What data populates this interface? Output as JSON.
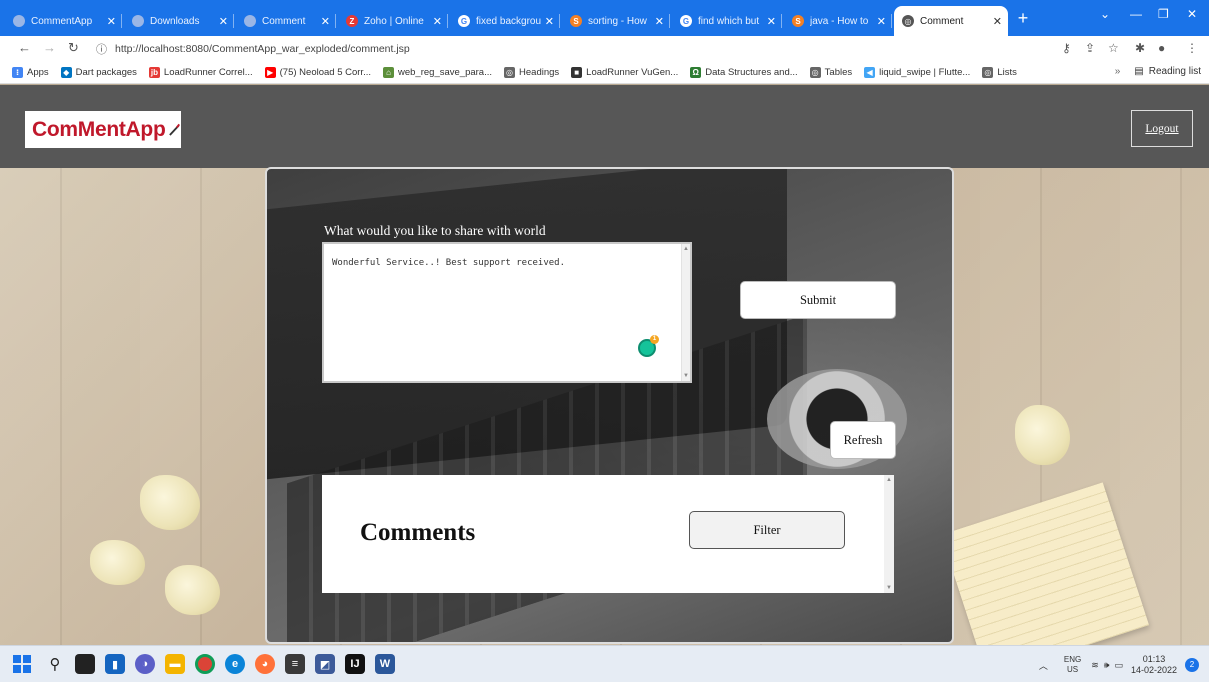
{
  "browser": {
    "tabs": [
      {
        "label": "CommentApp",
        "favicon_color": "#9ab6e6",
        "favicon": "",
        "active": false
      },
      {
        "label": "Downloads",
        "favicon_color": "#9ab6e6",
        "favicon": "",
        "active": false
      },
      {
        "label": "Comment",
        "favicon_color": "#9ab6e6",
        "favicon": "",
        "active": false
      },
      {
        "label": "Zoho | Online",
        "favicon_color": "#e53935",
        "favicon": "Z",
        "active": false
      },
      {
        "label": "fixed backgrou",
        "favicon_color": "#ffffff",
        "favicon": "G",
        "active": false
      },
      {
        "label": "sorting - How",
        "favicon_color": "#f48024",
        "favicon": "S",
        "active": false
      },
      {
        "label": "find which but",
        "favicon_color": "#ffffff",
        "favicon": "G",
        "active": false
      },
      {
        "label": "java - How to",
        "favicon_color": "#f48024",
        "favicon": "S",
        "active": false
      },
      {
        "label": "Comment",
        "favicon_color": "#555555",
        "favicon": "◎",
        "active": true
      }
    ],
    "url": "http://localhost:8080/CommentApp_war_exploded/comment.jsp",
    "bookmarks": [
      {
        "label": "Apps",
        "color": "#4285f4",
        "glyph": "⁝"
      },
      {
        "label": "Dart packages",
        "color": "#0175c2",
        "glyph": "◆"
      },
      {
        "label": "LoadRunner Correl...",
        "color": "#e53935",
        "glyph": "jb"
      },
      {
        "label": "(75) Neoload 5 Corr...",
        "color": "#ff0000",
        "glyph": "▶"
      },
      {
        "label": "web_reg_save_para...",
        "color": "#5c8f3a",
        "glyph": "⌂"
      },
      {
        "label": "Headings",
        "color": "#666666",
        "glyph": "◎"
      },
      {
        "label": "LoadRunner VuGen...",
        "color": "#333333",
        "glyph": "■"
      },
      {
        "label": "Data Structures and...",
        "color": "#2e7d32",
        "glyph": "Ω"
      },
      {
        "label": "Tables",
        "color": "#666666",
        "glyph": "◎"
      },
      {
        "label": "liquid_swipe | Flutte...",
        "color": "#42a5f5",
        "glyph": "◀"
      },
      {
        "label": "Lists",
        "color": "#666666",
        "glyph": "◎"
      }
    ],
    "reading_list": "Reading list",
    "more_bookmarks": "»"
  },
  "app": {
    "logo": "ComMentApp",
    "logout": "Logout",
    "prompt_label": "What would you like to share with world",
    "comment_text": "Wonderful Service..! Best support received.",
    "submit": "Submit",
    "refresh": "Refresh",
    "comments_heading": "Comments",
    "filter": "Filter"
  },
  "taskbar": {
    "lang_top": "ENG",
    "lang_bottom": "US",
    "time": "01:13",
    "date": "14-02-2022"
  }
}
